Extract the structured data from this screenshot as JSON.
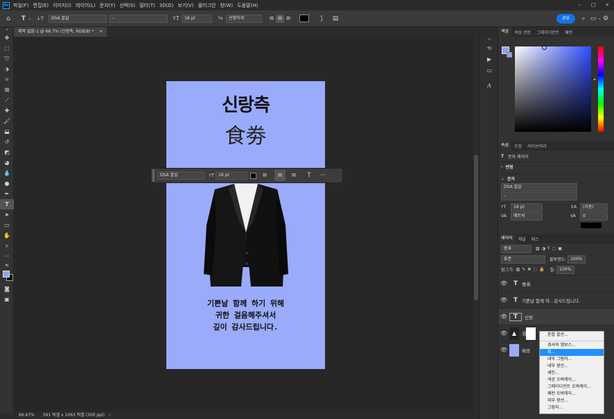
{
  "menu": {
    "items": [
      "파일(F)",
      "편집(E)",
      "이미지(I)",
      "레이어(L)",
      "문자(Y)",
      "선택(S)",
      "필터(T)",
      "3D(D)",
      "보기(V)",
      "플러그인",
      "창(W)",
      "도움말(H)"
    ]
  },
  "options": {
    "font_family": "DSA 꿀갈",
    "font_style": "-",
    "font_size": "18 pt",
    "aa_glyph": "ªa",
    "antialias": "선명하게",
    "share": "공유"
  },
  "tab": {
    "title": "제목 없음-1 @ 66.7% (신랑측, RGB/8) *",
    "close": "×"
  },
  "document": {
    "brand": "신랑측",
    "ticket": "食劵",
    "thanks": [
      "기쁜날 함께 하기 위해",
      "귀한 걸음해주셔서",
      "깊이 감사드립니다."
    ]
  },
  "ctxbar": {
    "font": "DSA 꿀갈",
    "size": "18 pt",
    "more": "···"
  },
  "status": {
    "zoom": "66.67%",
    "info": "591 픽셀 x 1063 픽셀 (300 ppi)"
  },
  "panel": {
    "color_tabs": [
      "색상",
      "색상 견본",
      "그레이디언트",
      "패턴"
    ],
    "props_tabs": [
      "속성",
      "조정",
      "라이브러리"
    ],
    "text_layer": "문자 레이어",
    "transform": "변형",
    "char": "문자",
    "font": "DSA 꿀갈",
    "style": "-",
    "size": "18 pt",
    "leading": "(자동)",
    "kerning": "메트릭",
    "tracking": "0",
    "layers_tabs": [
      "레이어",
      "채널",
      "패스"
    ],
    "kind": "종류",
    "blend": "표준",
    "opacity_label": "불투명도:",
    "opacity": "100%",
    "lock_label": "잠그기:",
    "fill_label": "칠:",
    "fill": "100%",
    "layers": [
      {
        "name": "食劵",
        "type": "T"
      },
      {
        "name": "기쁜날 함께 하...감사드립니다.",
        "type": "T"
      },
      {
        "name": "신랑",
        "type": "T"
      },
      {
        "name": "",
        "type": "img"
      },
      {
        "name": "배경",
        "type": "bg"
      }
    ]
  },
  "context_menu": {
    "items": [
      "혼합 옵션...",
      "경사와 엠보스...",
      "획...",
      "내부 그림자...",
      "내부 광선...",
      "새틴...",
      "색상 오버레이...",
      "그레이디언트 오버레이...",
      "패턴 오버레이...",
      "외부 광선...",
      "그림자..."
    ],
    "highlighted": 2
  },
  "colors": {
    "doc_bg": "#9aabfb",
    "accent": "#1473e6",
    "fg": "#8ea2f5",
    "bg": "#000000"
  }
}
